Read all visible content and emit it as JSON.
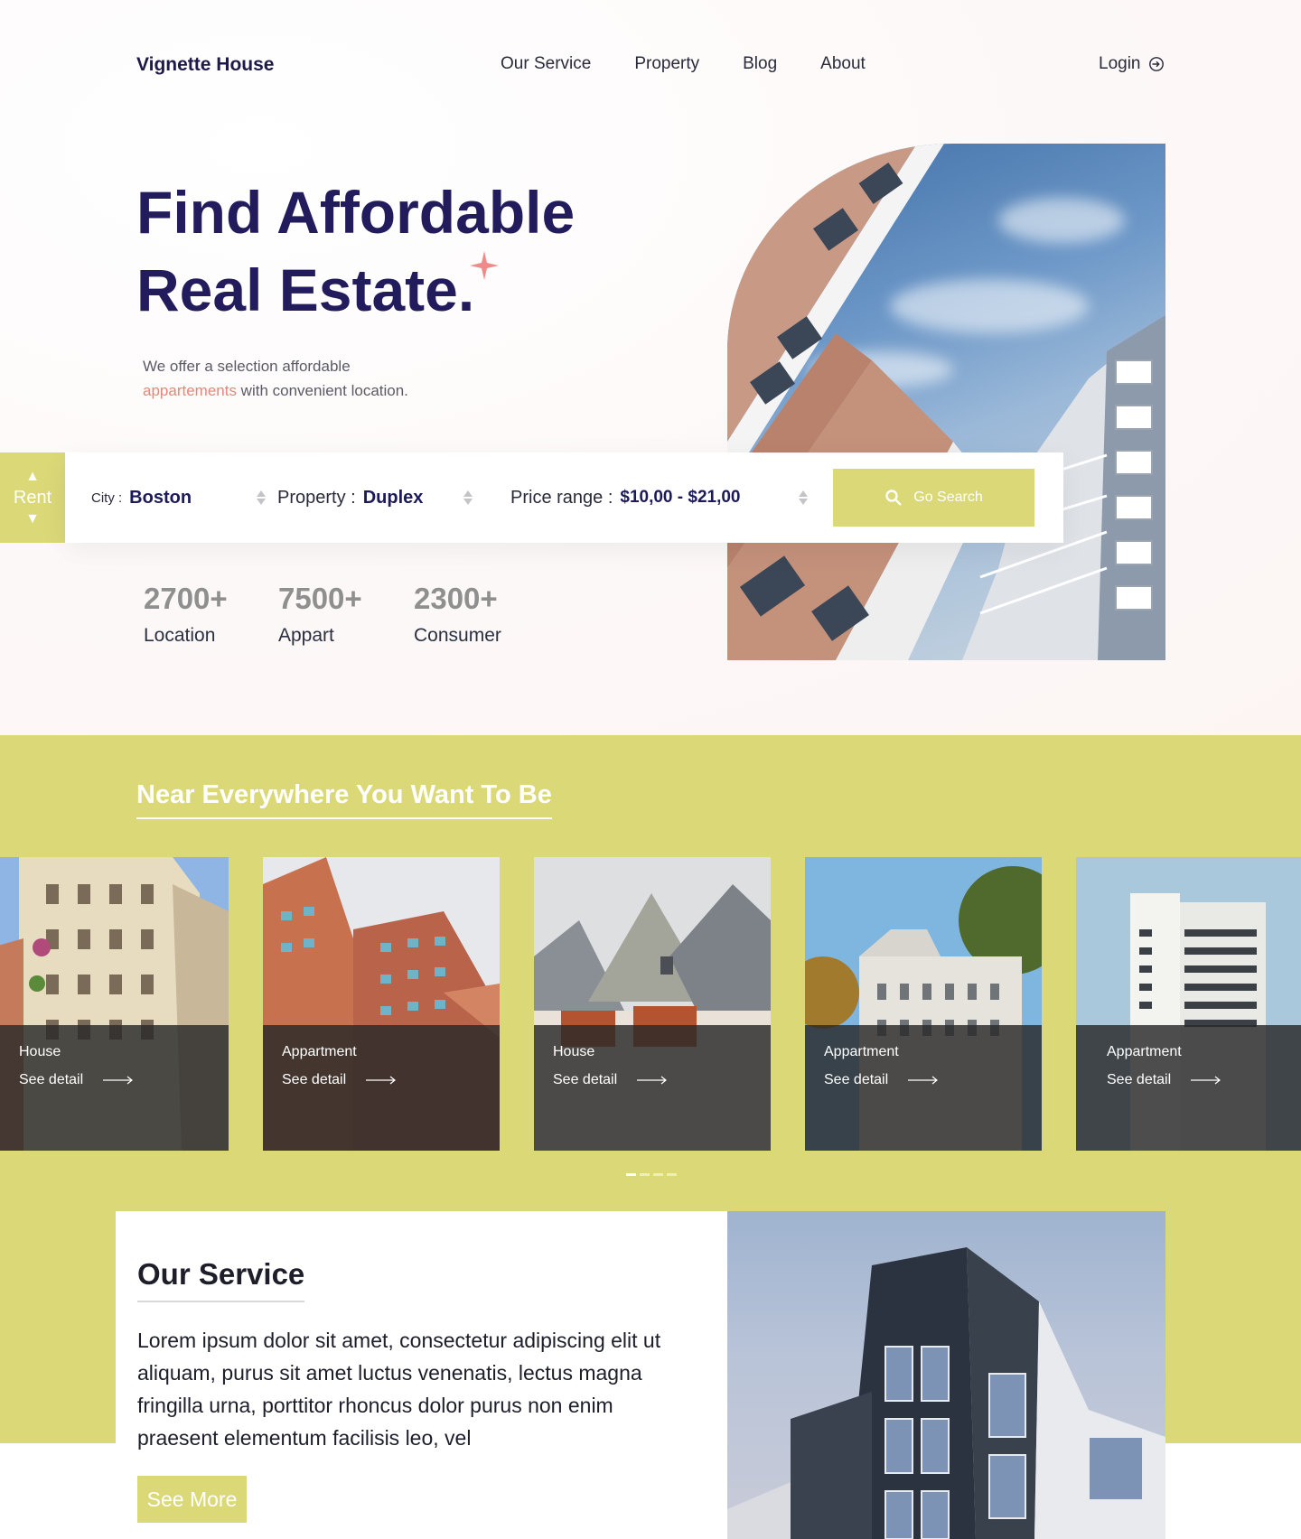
{
  "header": {
    "logo": "Vignette House",
    "nav": [
      "Our Service",
      "Property",
      "Blog",
      "About"
    ],
    "login": "Login"
  },
  "hero": {
    "title_line1": "Find Affordable",
    "title_line2": "Real Estate.",
    "desc_line1": "We offer a selection affordable",
    "desc_accent": "appartements",
    "desc_rest": " with convenient location."
  },
  "search": {
    "mode": "Rent",
    "city_label": "City :",
    "city_value": "Boston",
    "property_label": "Property :",
    "property_value": "Duplex",
    "price_label": "Price range :",
    "price_value": "$10,00 - $21,00",
    "button": "Go Search"
  },
  "stats": [
    {
      "number": "2700+",
      "label": "Location"
    },
    {
      "number": "7500+",
      "label": "Appart"
    },
    {
      "number": "2300+",
      "label": "Consumer"
    }
  ],
  "near": {
    "title": "Near Everywhere You Want To Be",
    "cards": [
      {
        "type": "House",
        "link": "See detail"
      },
      {
        "type": "Appartment",
        "link": "See detail"
      },
      {
        "type": "House",
        "link": "See detail"
      },
      {
        "type": "Appartment",
        "link": "See detail"
      },
      {
        "type": "Appartment",
        "link": "See detail"
      }
    ]
  },
  "service": {
    "title": "Our Service",
    "text": "Lorem ipsum dolor sit amet, consectetur adipiscing elit ut aliquam, purus sit amet luctus venenatis, lectus magna fringilla urna, porttitor rhoncus dolor purus non enim praesent elementum facilisis leo, vel",
    "button": "See More"
  },
  "colors": {
    "accent": "#dbd878",
    "heading": "#221c5c",
    "highlight": "#e9857a"
  }
}
